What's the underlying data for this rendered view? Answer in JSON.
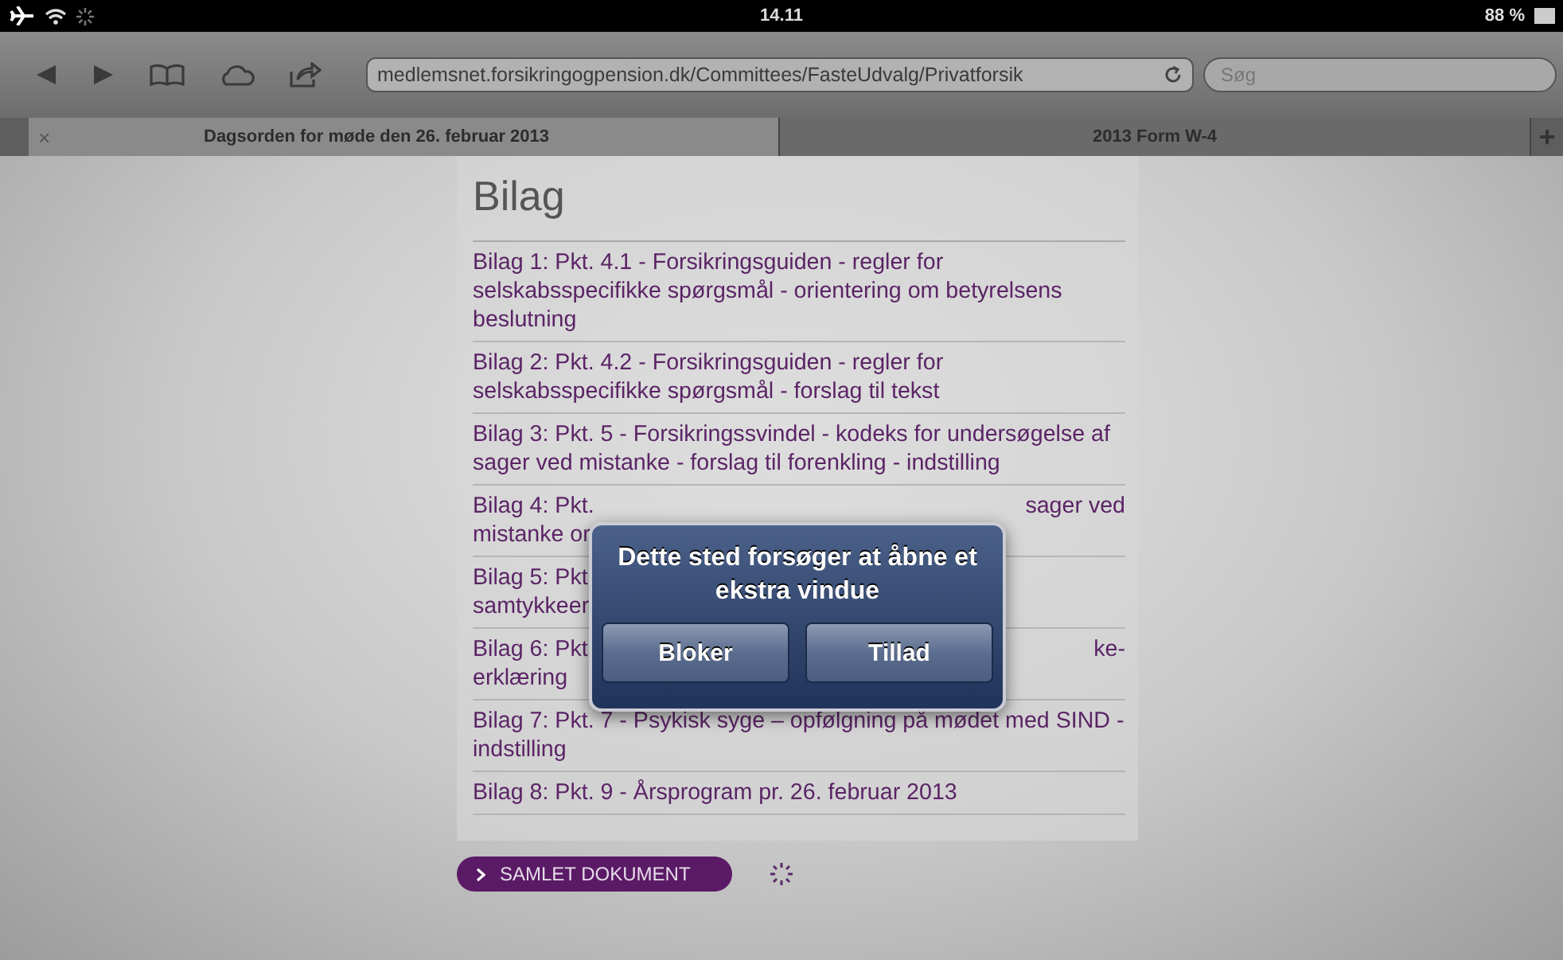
{
  "status_bar": {
    "time": "14.11",
    "battery": "88 %"
  },
  "toolbar": {
    "url": "medlemsnet.forsikringogpension.dk/Committees/FasteUdvalg/Privatforsik",
    "search": {
      "placeholder": "Søg"
    }
  },
  "tabs": [
    {
      "label": "Dagsorden for møde den 26. februar 2013",
      "selected": true,
      "close": "×"
    },
    {
      "label": "2013 Form W-4",
      "selected": false
    }
  ],
  "new_tab": "+",
  "heading": "Bilag",
  "items": [
    {
      "lines": [
        {
          "left": "Bilag 1: Pkt. 4.1 - Forsikringsguiden - regler for"
        },
        {
          "left": "selskabsspecifikke spørgsmål - orientering om betyrelsens"
        },
        {
          "left": "beslutning"
        }
      ]
    },
    {
      "lines": [
        {
          "left": "Bilag 2: Pkt. 4.2 - Forsikringsguiden - regler for"
        },
        {
          "left": "selskabsspecifikke spørgsmål - forslag til tekst"
        }
      ]
    },
    {
      "lines": [
        {
          "left": "Bilag 3: Pkt. 5 - Forsikringssvindel - kodeks for undersøgelse af"
        },
        {
          "left": "sager ved mistanke - forslag til forenkling - indstilling"
        }
      ]
    },
    {
      "lines": [
        {
          "left": "Bilag 4: Pkt.",
          "right": "sager ved"
        },
        {
          "left": "mistanke or"
        }
      ]
    },
    {
      "lines": [
        {
          "left": "Bilag 5: Pkt"
        },
        {
          "left": "samtykkeer"
        }
      ]
    },
    {
      "lines": [
        {
          "left": "Bilag 6: Pkt",
          "right": "ke-"
        },
        {
          "left": "erklæring"
        }
      ]
    },
    {
      "lines": [
        {
          "left": "Bilag 7: Pkt. 7 - Psykisk syge – opfølgning på mødet med SIND -"
        },
        {
          "left": "indstilling"
        }
      ]
    },
    {
      "lines": [
        {
          "left": "Bilag 8: Pkt. 9 - Årsprogram pr. 26. februar 2013"
        }
      ]
    }
  ],
  "document_button": {
    "label": "SAMLET DOKUMENT"
  },
  "alert": {
    "message": "Dette sted forsøger at åbne et ekstra vindue",
    "buttons": [
      "Bloker",
      "Tillad"
    ]
  }
}
